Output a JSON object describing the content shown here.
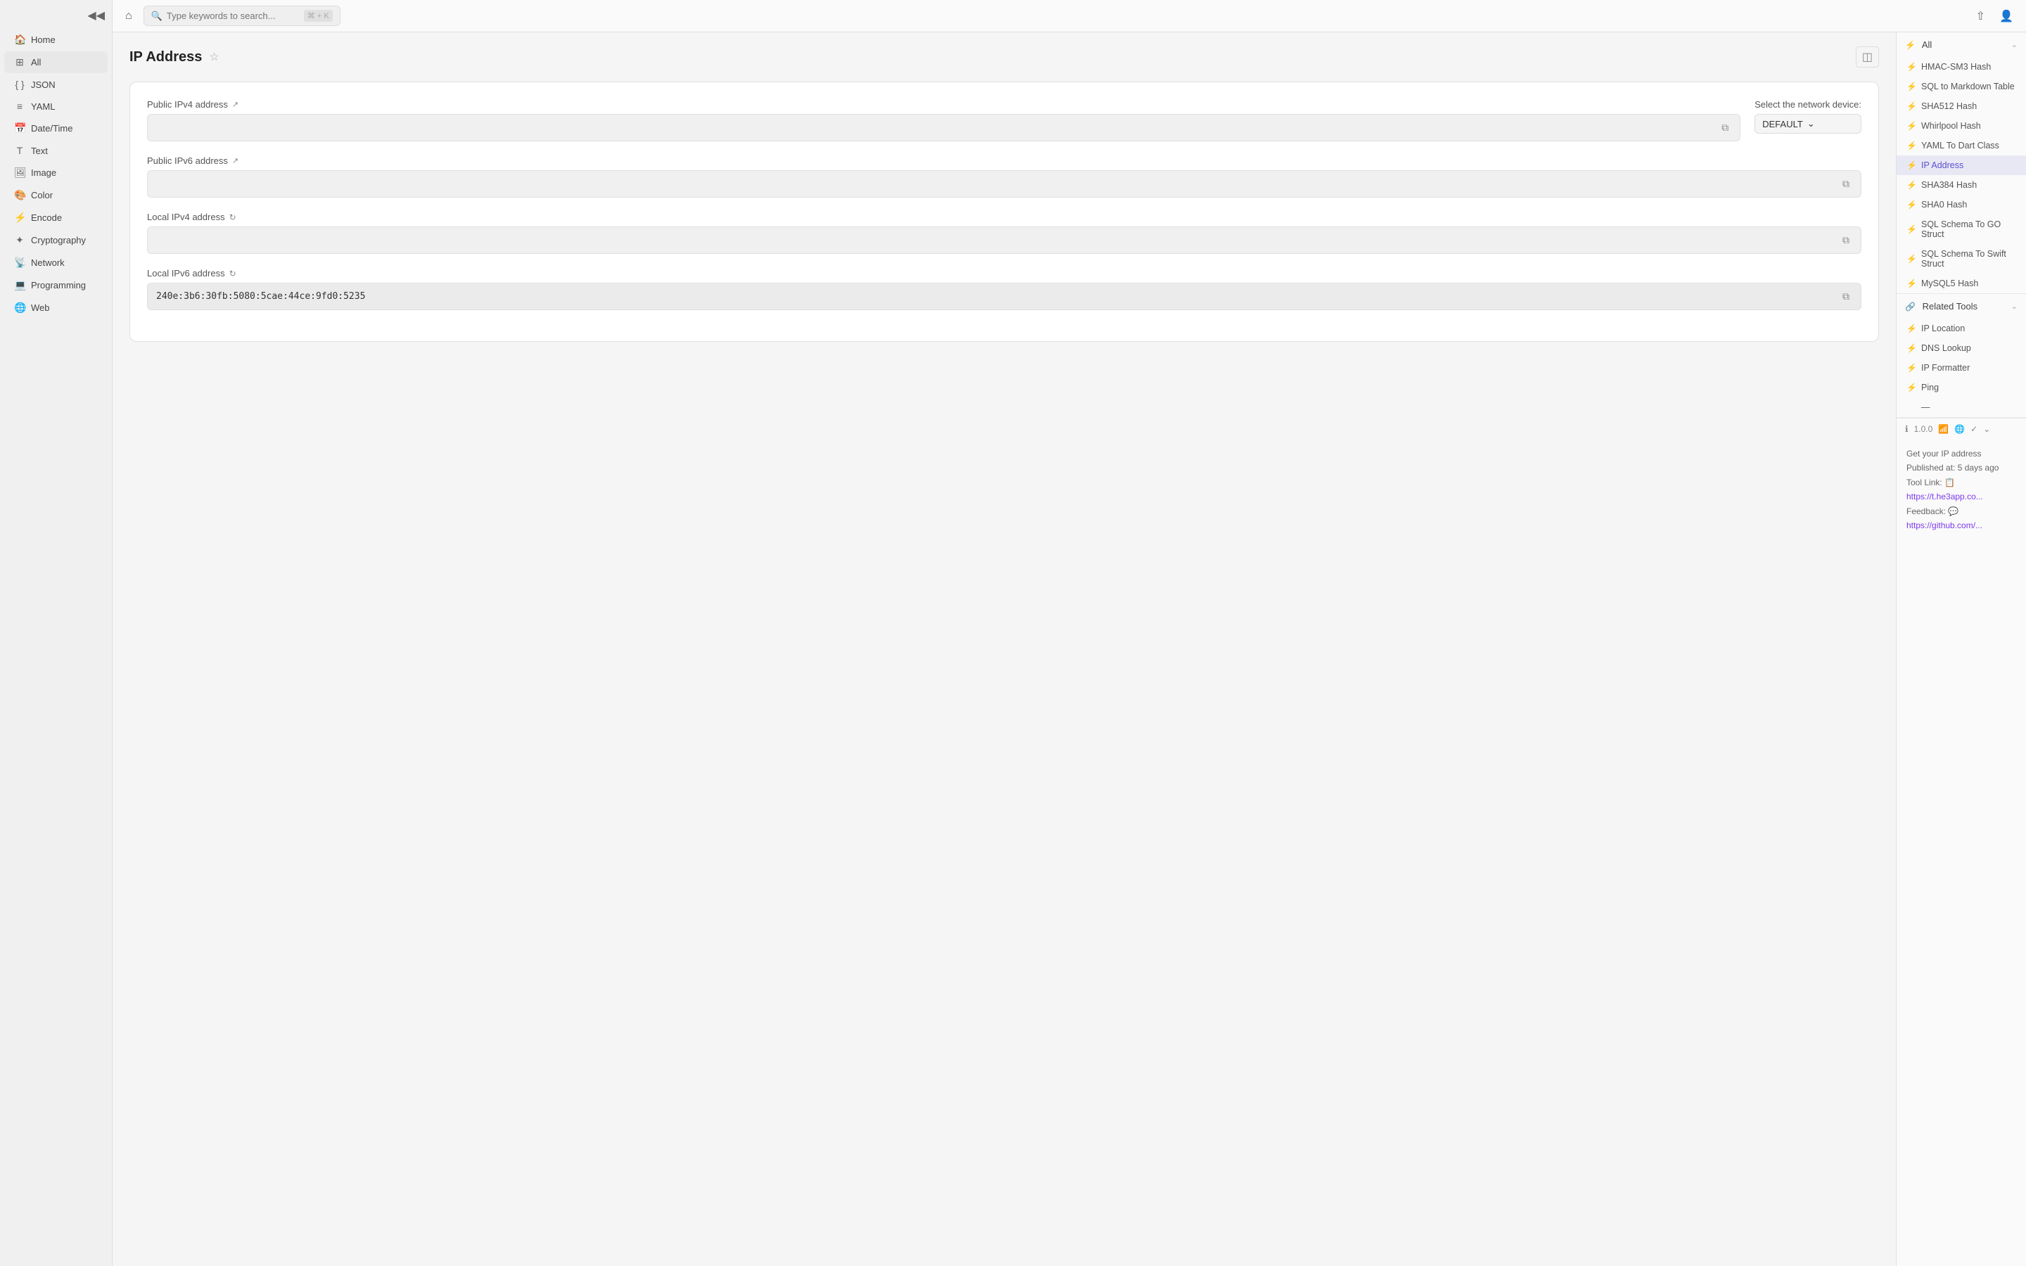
{
  "sidebar": {
    "items": [
      {
        "id": "home",
        "label": "Home",
        "icon": "🏠"
      },
      {
        "id": "all",
        "label": "All",
        "icon": "⊞",
        "active": true
      },
      {
        "id": "json",
        "label": "JSON",
        "icon": "{ }"
      },
      {
        "id": "yaml",
        "label": "YAML",
        "icon": "≡"
      },
      {
        "id": "datetime",
        "label": "Date/Time",
        "icon": "📅"
      },
      {
        "id": "text",
        "label": "Text",
        "icon": "T"
      },
      {
        "id": "image",
        "label": "Image",
        "icon": "🖼"
      },
      {
        "id": "color",
        "label": "Color",
        "icon": "🎨"
      },
      {
        "id": "encode",
        "label": "Encode",
        "icon": "⚡"
      },
      {
        "id": "cryptography",
        "label": "Cryptography",
        "icon": "✦"
      },
      {
        "id": "network",
        "label": "Network",
        "icon": "📡"
      },
      {
        "id": "programming",
        "label": "Programming",
        "icon": "💻"
      },
      {
        "id": "web",
        "label": "Web",
        "icon": "🌐"
      }
    ],
    "toggle_icon": "◀◀"
  },
  "topbar": {
    "home_icon": "⌂",
    "search_placeholder": "Type keywords to search...",
    "shortcut": "⌘ + K",
    "share_icon": "⇧",
    "user_icon": "👤"
  },
  "tool": {
    "title": "IP Address",
    "star_icon": "☆",
    "collapse_icon": "◫",
    "fields": [
      {
        "id": "ipv4-public",
        "label": "Public IPv4 address",
        "value": "",
        "has_refresh": false,
        "has_arrow": true
      },
      {
        "id": "ipv6-public",
        "label": "Public IPv6 address",
        "value": "",
        "has_refresh": false,
        "has_arrow": true
      },
      {
        "id": "ipv4-local",
        "label": "Local IPv4 address",
        "value": "",
        "has_refresh": true,
        "has_arrow": false
      },
      {
        "id": "ipv6-local",
        "label": "Local IPv6 address",
        "value": "240e:3b6:30fb:5080:5cae:44ce:9fd0:5235",
        "has_refresh": true,
        "has_arrow": false
      }
    ],
    "network_label": "Select the network device:",
    "network_value": "DEFAULT",
    "copy_icon": "⧉"
  },
  "right_panel": {
    "all_section": {
      "label": "All",
      "icon": "⚡",
      "chevron": "⌄",
      "items": [
        {
          "label": "HMAC-SM3 Hash",
          "icon": "⚡"
        },
        {
          "label": "SQL to Markdown Table",
          "icon": "⚡"
        },
        {
          "label": "SHA512 Hash",
          "icon": "⚡"
        },
        {
          "label": "Whirlpool Hash",
          "icon": "⚡"
        },
        {
          "label": "YAML To Dart Class",
          "icon": "⚡"
        },
        {
          "label": "IP Address",
          "icon": "⚡",
          "active": true
        },
        {
          "label": "SHA384 Hash",
          "icon": "⚡"
        },
        {
          "label": "SHA0 Hash",
          "icon": "⚡"
        },
        {
          "label": "SQL Schema To GO Struct",
          "icon": "⚡"
        },
        {
          "label": "SQL Schema To Swift Struct",
          "icon": "⚡"
        },
        {
          "label": "MySQL5 Hash",
          "icon": "⚡"
        }
      ]
    },
    "related_section": {
      "label": "Related Tools",
      "icon": "🔗",
      "chevron": "⌄",
      "items": [
        {
          "label": "IP Location",
          "icon": "⚡"
        },
        {
          "label": "DNS Lookup",
          "icon": "⚡"
        },
        {
          "label": "IP Formatter",
          "icon": "⚡"
        },
        {
          "label": "Ping",
          "icon": "⚡"
        },
        {
          "label": "—",
          "icon": ""
        }
      ]
    },
    "version": {
      "number": "1.0.0",
      "wifi_icon": "📶",
      "globe_icon": "🌐",
      "check_icon": "✓",
      "chevron": "⌄",
      "description": "Get your IP address",
      "published": "Published at: 5 days ago",
      "tool_link_label": "Tool Link:",
      "tool_link": "https://t.he3app.co...",
      "feedback_label": "Feedback:",
      "feedback_link": "https://github.com/..."
    }
  }
}
